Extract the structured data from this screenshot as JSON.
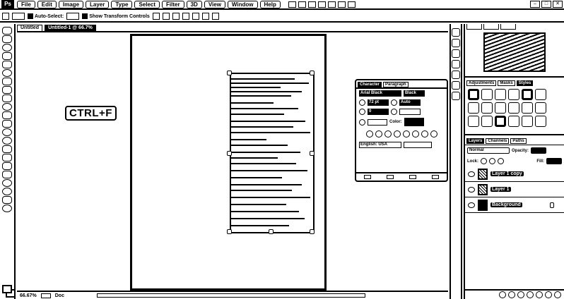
{
  "menubar": {
    "logo": "Ps",
    "items": [
      "File",
      "Edit",
      "Image",
      "Layer",
      "Type",
      "Select",
      "Filter",
      "3D",
      "View",
      "Window",
      "Help"
    ]
  },
  "optionsbar": {
    "auto_select_label": "Auto-Select:",
    "show_transform_label": "Show Transform Controls"
  },
  "tabs": [
    {
      "label": "Untitled",
      "active": false
    },
    {
      "label": "Untitled-1 @ 66.7%",
      "active": true
    }
  ],
  "canvas": {
    "overlay_text": "CTRL+F"
  },
  "statusbar": {
    "zoom": "66.67%",
    "doc_info": "Doc"
  },
  "character_panel": {
    "tabs": [
      "Character",
      "Paragraph"
    ],
    "font_family": "Arial Black",
    "font_style": "Black",
    "size": "72 pt",
    "leading": "Auto",
    "tracking": "0",
    "color_label": "Color:",
    "language": "English: USA"
  },
  "styles_panel": {
    "tabs": [
      "Adjustments",
      "Masks",
      "Styles"
    ]
  },
  "layers_panel": {
    "tabs": [
      "Layers",
      "Channels",
      "Paths"
    ],
    "blend_mode": "Normal",
    "opacity_label": "Opacity:",
    "lock_label": "Lock:",
    "fill_label": "Fill:",
    "layers": [
      {
        "name": "Layer 1 copy",
        "thumb": "pattern",
        "locked": false
      },
      {
        "name": "Layer 1",
        "thumb": "pattern",
        "locked": false
      },
      {
        "name": "Background",
        "thumb": "solid",
        "locked": true
      }
    ]
  }
}
